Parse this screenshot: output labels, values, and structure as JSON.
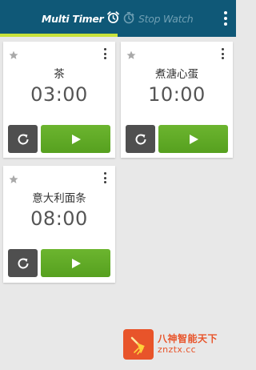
{
  "header": {
    "tabs": [
      {
        "label": "Multi Timer",
        "icon": "alarm-clock-icon",
        "active": true
      },
      {
        "label": "Stop Watch",
        "icon": "stopwatch-icon",
        "active": false
      }
    ],
    "menu_icon": "overflow-menu-icon"
  },
  "timers": [
    {
      "name": "茶",
      "time": "03:00",
      "starred": false
    },
    {
      "name": "煮溏心蛋",
      "time": "10:00",
      "starred": false
    },
    {
      "name": "意大利面条",
      "time": "08:00",
      "starred": false
    }
  ],
  "card_controls": {
    "reset_icon": "reset-icon",
    "play_icon": "play-icon",
    "star_icon": "star-icon",
    "menu_icon": "card-menu-icon"
  },
  "watermark": {
    "title": "八神智能天下",
    "url": "znztx.cc"
  },
  "colors": {
    "header_bg": "#0f5877",
    "tab_underline": "#c8e23a",
    "play_button": "#5ea826",
    "reset_button": "#4f4f4f",
    "watermark": "#e8542a"
  }
}
